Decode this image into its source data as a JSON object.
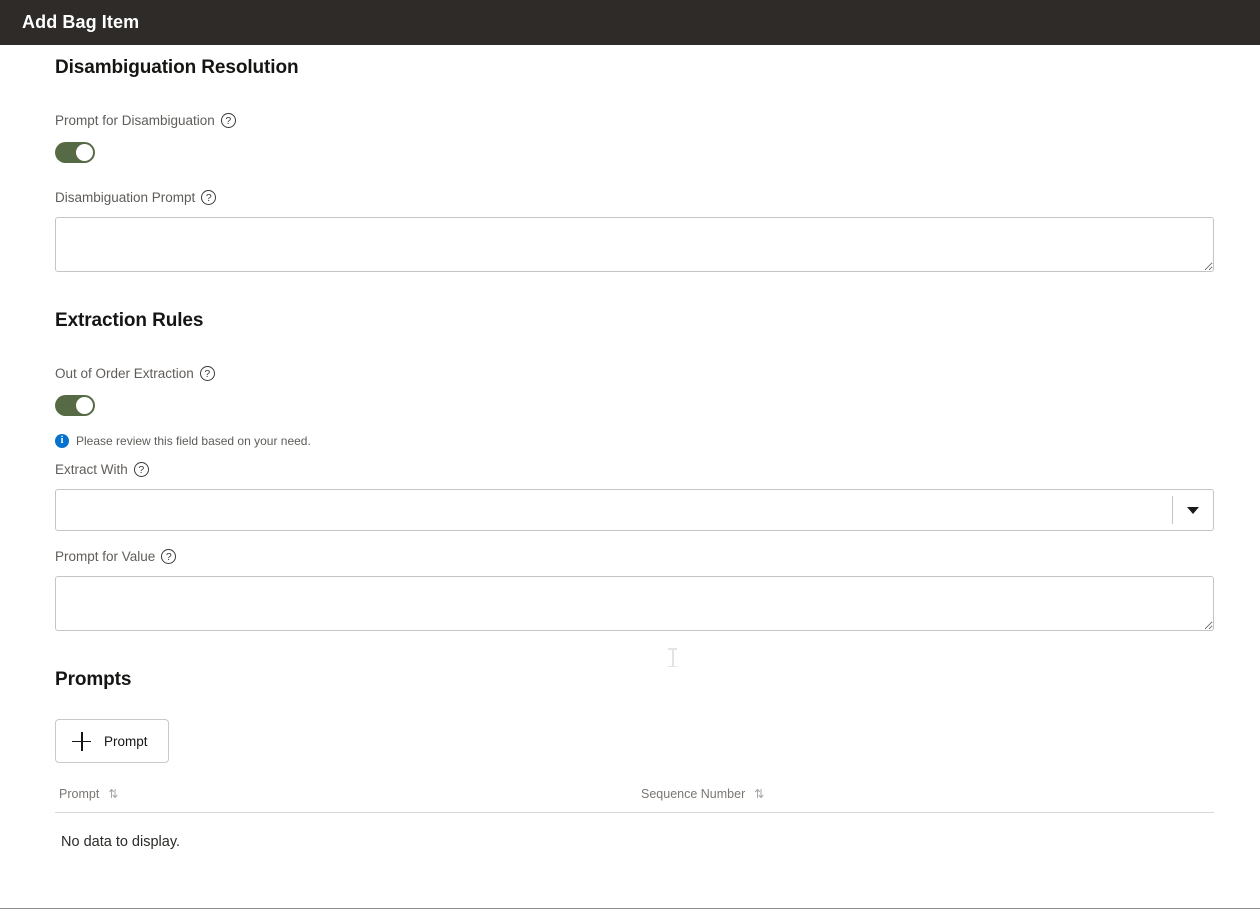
{
  "window": {
    "title": "Add Bag Item",
    "header_bg": "#2e2b29"
  },
  "colors": {
    "toggle_on": "#566b45",
    "info_blue": "#0572ce",
    "border": "#c4c4c4",
    "label_gray": "#605d59"
  },
  "sections": {
    "disambiguation": {
      "title": "Disambiguation Resolution",
      "prompt_for_disambiguation": {
        "label": "Prompt for Disambiguation",
        "toggle_state": "on"
      },
      "disambiguation_prompt": {
        "label": "Disambiguation Prompt",
        "value": "",
        "placeholder": ""
      }
    },
    "extraction_rules": {
      "title": "Extraction Rules",
      "out_of_order_extraction": {
        "label": "Out of Order Extraction",
        "toggle_state": "on"
      },
      "info_message": "Please review this field based on your need.",
      "extract_with": {
        "label": "Extract With",
        "value": "",
        "placeholder": ""
      },
      "prompt_for_value": {
        "label": "Prompt for Value",
        "value": "",
        "placeholder": ""
      }
    },
    "prompts": {
      "title": "Prompts",
      "add_button_label": "Prompt",
      "add_button_icon": "plus-icon",
      "table": {
        "columns": [
          {
            "label": "Prompt",
            "sort_icon": "⇅"
          },
          {
            "label": "Sequence Number",
            "sort_icon": "⇅"
          }
        ],
        "empty_message": "No data to display.",
        "rows": []
      }
    }
  }
}
